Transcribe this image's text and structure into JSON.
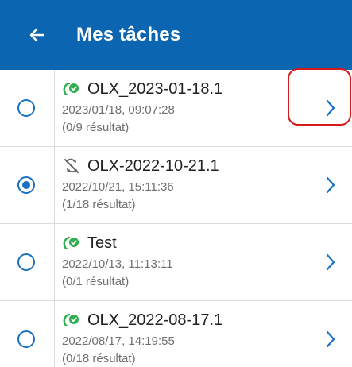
{
  "header": {
    "title": "Mes tâches",
    "back_icon": "arrow-left-icon",
    "background": "#0b65b0"
  },
  "tasks": [
    {
      "name": "OLX_2023-01-18.1",
      "date": "2023/01/18, 09:07:28",
      "results": "(0/9 résultat)",
      "status_icon": "sync-check-icon",
      "selected": false
    },
    {
      "name": "OLX-2022-10-21.1",
      "date": "2022/10/21, 15:11:36",
      "results": "(1/18 résultat)",
      "status_icon": "sync-off-icon",
      "selected": true
    },
    {
      "name": "Test",
      "date": "2022/10/13, 11:13:11",
      "results": "(0/1 résultat)",
      "status_icon": "sync-check-icon",
      "selected": false
    },
    {
      "name": "OLX_2022-08-17.1",
      "date": "2022/08/17, 14:19:55",
      "results": "(0/18 résultat)",
      "status_icon": "sync-check-icon",
      "selected": false
    }
  ],
  "colors": {
    "accent": "#1971c2",
    "status_green": "#2fae4f",
    "highlight": "#d61a1a"
  }
}
